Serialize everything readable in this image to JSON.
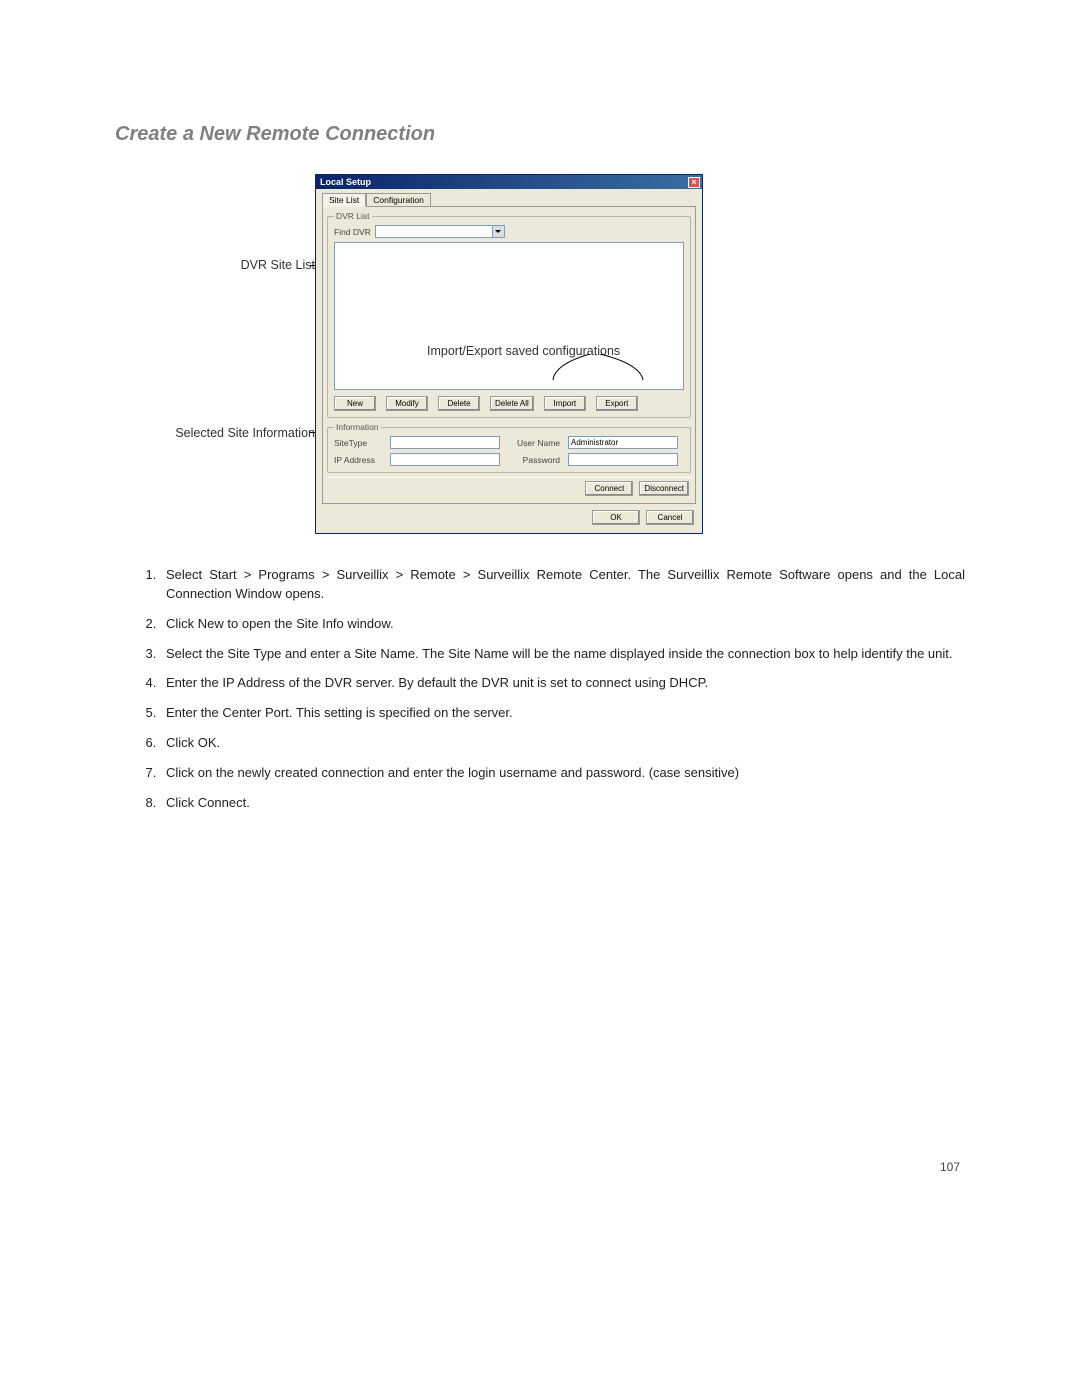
{
  "heading": "Create a New Remote Connection",
  "callouts": {
    "dvr_site_list": "DVR Site List",
    "selected_site_info": "Selected Site Information",
    "import_export": "Import/Export saved configurations"
  },
  "window": {
    "title": "Local Setup",
    "tabs": {
      "site_list": "Site List",
      "configuration": "Configuration"
    },
    "dvr_list": {
      "legend": "DVR List",
      "find_label": "Find DVR"
    },
    "buttons": {
      "new": "New",
      "modify": "Modify",
      "delete": "Delete",
      "delete_all": "Delete All",
      "import": "Import",
      "export": "Export"
    },
    "information": {
      "legend": "Information",
      "site_type_label": "SiteType",
      "ip_address_label": "IP Address",
      "user_name_label": "User Name",
      "password_label": "Password",
      "user_name_value": "Administrator"
    },
    "actions": {
      "connect": "Connect",
      "disconnect": "Disconnect",
      "ok": "OK",
      "cancel": "Cancel"
    }
  },
  "steps": [
    "Select Start > Programs > Surveillix > Remote > Surveillix Remote Center.  The Surveillix Remote Software opens and the Local Connection Window opens.",
    "Click New to open the Site Info window.",
    "Select the Site Type and enter a Site Name.  The Site Name will be the name displayed inside the connection box to help identify the unit.",
    "Enter the IP Address of the DVR server.  By default the DVR unit is set to connect using DHCP.",
    "Enter the Center Port.  This setting is specified on the server.",
    "Click OK.",
    "Click on the newly created connection and enter the login username and password. (case sensitive)",
    "Click Connect."
  ],
  "page_number": "107"
}
